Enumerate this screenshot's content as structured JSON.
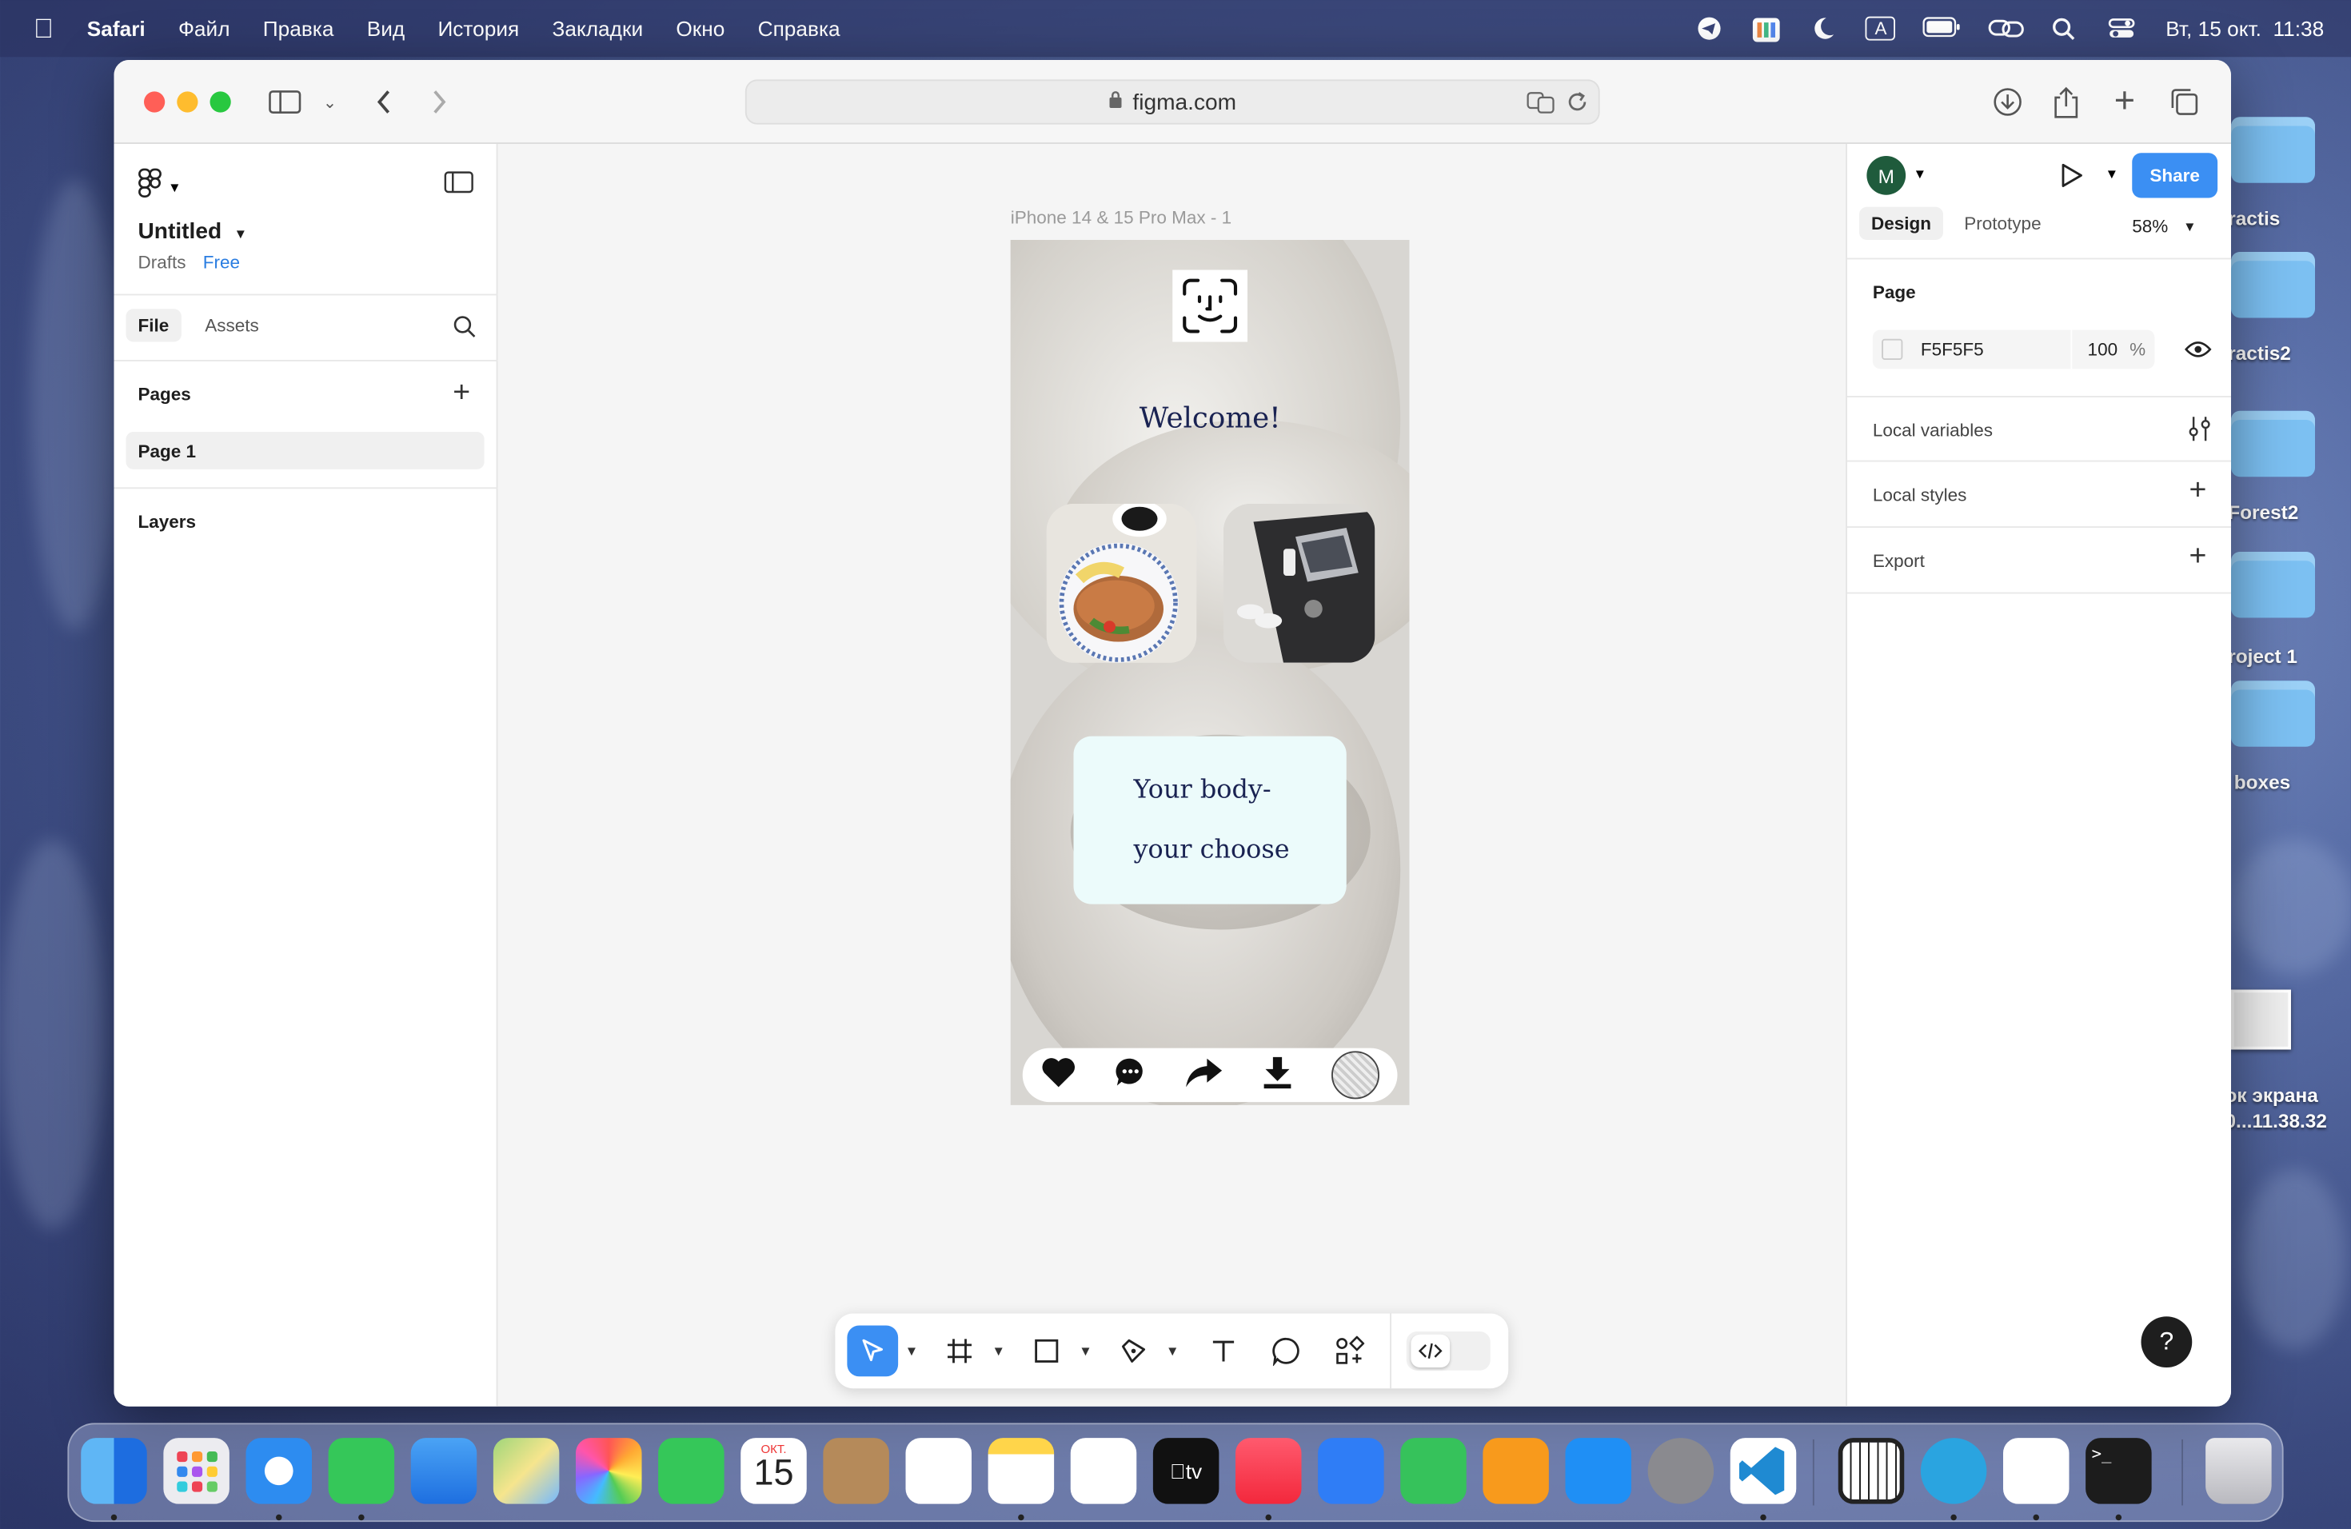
{
  "menubar": {
    "app_name": "Safari",
    "items": [
      "Файл",
      "Правка",
      "Вид",
      "История",
      "Закладки",
      "Окно",
      "Справка"
    ],
    "input_source": "A",
    "datetime": "Вт, 15 окт.  11:38"
  },
  "desktop": {
    "items": [
      {
        "label": "ractis"
      },
      {
        "label": "ractis2"
      },
      {
        "label": "Forest2"
      },
      {
        "label": "roject 1"
      },
      {
        "label": "boxes"
      },
      {
        "label": "ок экрана\n0...11.38.32"
      }
    ]
  },
  "browser": {
    "url": "figma.com",
    "icons": [
      "sidebar-icon",
      "chevron-down-icon",
      "back-icon",
      "forward-icon",
      "lock-icon",
      "translate-icon",
      "reload-icon",
      "download-icon",
      "share-icon",
      "new-tab-icon",
      "tabs-overview-icon"
    ]
  },
  "figma": {
    "file_name": "Untitled",
    "location": "Drafts",
    "plan": "Free",
    "left_tabs": [
      "File",
      "Assets"
    ],
    "pages_header": "Pages",
    "pages": [
      "Page 1"
    ],
    "layers_header": "Layers",
    "frame_label": "iPhone 14 & 15 Pro Max - 1",
    "avatar_letter": "M",
    "share_label": "Share",
    "right_tabs": [
      "Design",
      "Prototype"
    ],
    "zoom": "58%",
    "page_section": "Page",
    "page_color": "F5F5F5",
    "page_opacity": "100",
    "percent_sign": "%",
    "local_variables": "Local variables",
    "local_styles": "Local styles",
    "export": "Export",
    "help": "?",
    "tools": [
      "move-tool",
      "frame-tool",
      "rectangle-tool",
      "pen-tool",
      "text-tool",
      "comment-tool",
      "components-tool",
      "dev-mode-toggle"
    ]
  },
  "design": {
    "welcome": "Welcome!",
    "cta_line1": "Your body-",
    "cta_line2": "your choose",
    "nav_icons": [
      "heart-icon",
      "chat-icon",
      "share-arrow-icon",
      "download-icon",
      "profile-avatar"
    ]
  },
  "dock": {
    "calendar_month": "ОКТ.",
    "calendar_day": "15",
    "apps": [
      "Finder",
      "Launchpad",
      "Safari",
      "Messages",
      "Mail",
      "Maps",
      "Photos",
      "FaceTime",
      "Calendar",
      "Contacts",
      "Reminders",
      "Notes",
      "Freeform",
      "TV",
      "Music",
      "Keynote",
      "Numbers",
      "Pages",
      "App Store",
      "System Settings",
      "VS Code",
      "Piano",
      "Telegram",
      "Toolbox",
      "Terminal",
      "Trash"
    ]
  },
  "colors": {
    "accent_blue": "#3b8ff3",
    "figma_dark": "#1e1e1e",
    "cta_bg": "#ecfbfb",
    "cta_text": "#1a2352"
  }
}
